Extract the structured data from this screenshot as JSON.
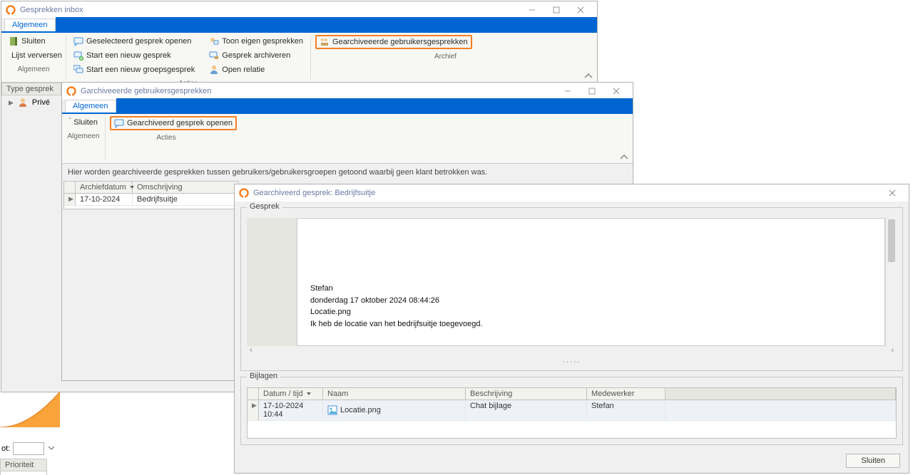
{
  "inbox": {
    "title": "Gesprekken inbox",
    "tab": "Algemeen",
    "groups": {
      "algemeen_label": "Algemeen",
      "acties_label": "Acties",
      "archief_label": "Archief"
    },
    "btns": {
      "sluiten": "Sluiten",
      "lijst_verversen": "Lijst verversen",
      "gesel_openen": "Geselecteerd gesprek openen",
      "nieuw_gesprek": "Start een nieuw gesprek",
      "nieuw_groeps": "Start een nieuw groepsgesprek",
      "toon_eigen": "Toon eigen gesprekken",
      "gesprek_arch": "Gesprek archiveren",
      "open_relatie": "Open relatie",
      "garch_gebruikers": "Gearchiveeerde gebruikersgesprekken"
    },
    "side": {
      "type_gesprek": "Type gesprek",
      "prive": "Privé"
    },
    "frag": {
      "ot_label": "ot:",
      "prioriteit": "Prioriteit"
    }
  },
  "arch_users": {
    "title": "Garchiveeerde gebruikersgesprekken",
    "tab": "Algemeen",
    "groups": {
      "algemeen_label": "Algemeen",
      "acties_label": "Acties"
    },
    "btns": {
      "sluiten": "Sluiten",
      "gearch_openen": "Gearchiveerd gesprek openen"
    },
    "helptext": "Hier worden gearchiveerde gesprekken tussen gebruikers/gebruikersgroepen getoond waarbij geen klant betrokken was.",
    "grid": {
      "col_archiefdatum": "Archiefdatum",
      "col_omschrijving": "Omschrijving",
      "row_date": "17-10-2024",
      "row_desc": "Bedrijfsuitje"
    }
  },
  "detail": {
    "title": "Gearchiveerd gesprek: Bedrijfsuitje",
    "section_gesprek": "Gesprek",
    "section_bijlagen": "Bijlagen",
    "msg": {
      "author": "Stefan",
      "when": "donderdag 17 oktober 2024 08:44:26",
      "file": "Locatie.png",
      "body": "Ik heb de locatie van het bedrijfsuitje toegevoegd."
    },
    "att_grid": {
      "col_datum": "Datum / tijd",
      "col_naam": "Naam",
      "col_besch": "Beschrijving",
      "col_medew": "Medewerker",
      "row_datum": "17-10-2024 10:44",
      "row_naam": "Locatie.png",
      "row_besch": "Chat bijlage",
      "row_medew": "Stefan"
    },
    "sluiten_btn": "Sluiten"
  }
}
